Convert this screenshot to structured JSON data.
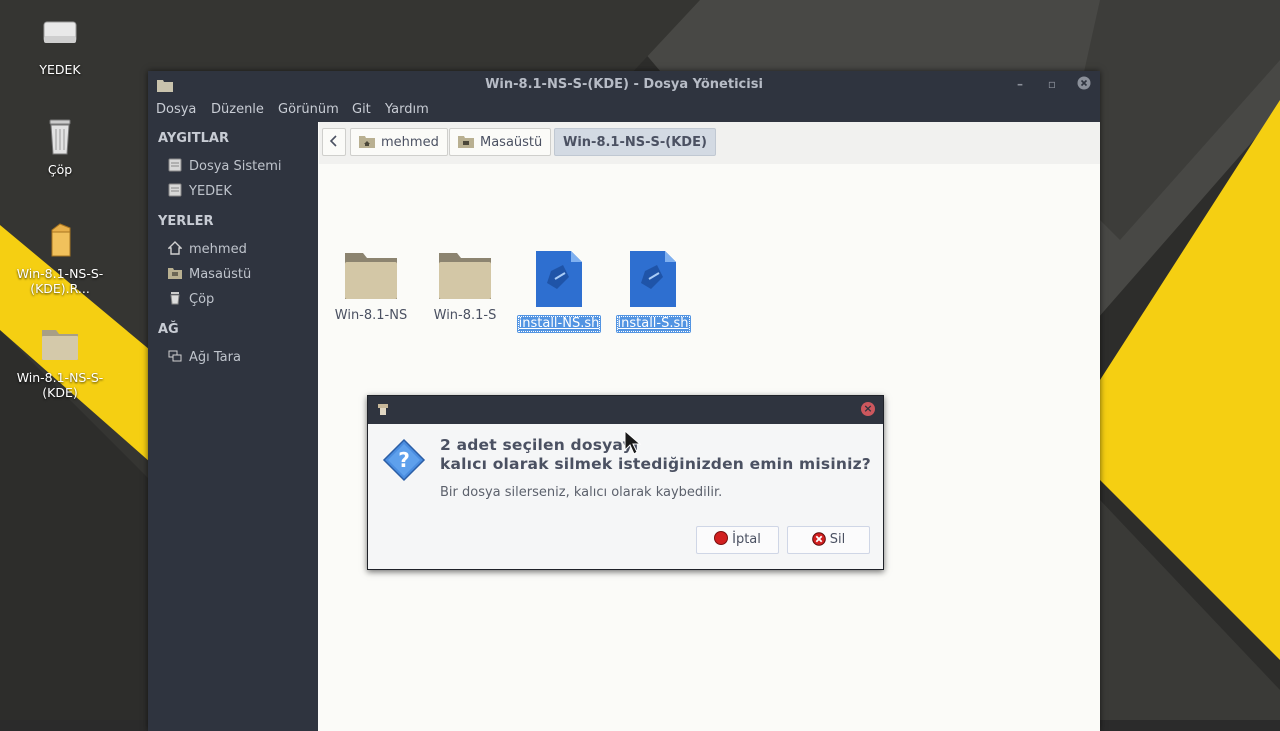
{
  "desktop": {
    "icons": [
      {
        "label": "YEDEK",
        "icon": "drive-icon"
      },
      {
        "label": "Çöp",
        "icon": "trash-icon"
      },
      {
        "label": "Win-8.1-NS-S-(KDE).R...",
        "icon": "archive-icon"
      },
      {
        "label": "Win-8.1-NS-S-(KDE)",
        "icon": "folder-icon"
      }
    ]
  },
  "window": {
    "title": "Win-8.1-NS-S-(KDE) - Dosya Yöneticisi",
    "menu": [
      "Dosya",
      "Düzenle",
      "Görünüm",
      "Git",
      "Yardım"
    ],
    "sidebar": {
      "sections": [
        {
          "heading": "AYGITLAR",
          "items": [
            {
              "label": "Dosya Sistemi",
              "icon": "drive-icon"
            },
            {
              "label": "YEDEK",
              "icon": "drive-icon"
            }
          ]
        },
        {
          "heading": "YERLER",
          "items": [
            {
              "label": "mehmed",
              "icon": "home-icon"
            },
            {
              "label": "Masaüstü",
              "icon": "desktop-folder-icon"
            },
            {
              "label": "Çöp",
              "icon": "trash-icon"
            }
          ]
        },
        {
          "heading": "AĞ",
          "items": [
            {
              "label": "Ağı Tara",
              "icon": "network-icon"
            }
          ]
        }
      ]
    },
    "pathbar": {
      "back_icon": "chevron-left-icon",
      "crumbs": [
        "mehmed",
        "Masaüstü",
        "Win-8.1-NS-S-(KDE)"
      ]
    },
    "files": [
      {
        "name": "Win-8.1-NS",
        "type": "folder",
        "selected": false
      },
      {
        "name": "Win-8.1-S",
        "type": "folder",
        "selected": false
      },
      {
        "name": "install-NS.sh",
        "type": "script",
        "selected": true
      },
      {
        "name": "install-S.sh",
        "type": "script",
        "selected": true
      }
    ]
  },
  "dialog": {
    "heading_line1": "2 adet seçilen dosyayı",
    "heading_line2": "kalıcı olarak silmek istediğinizden emin misiniz?",
    "message": "Bir dosya silerseniz, kalıcı olarak kaybedilir.",
    "cancel_label": "İptal",
    "delete_label": "Sil"
  },
  "colors": {
    "accent": "#5294e2",
    "titlebar": "#2f343f",
    "wallpaper_yellow": "#f5cf12"
  }
}
